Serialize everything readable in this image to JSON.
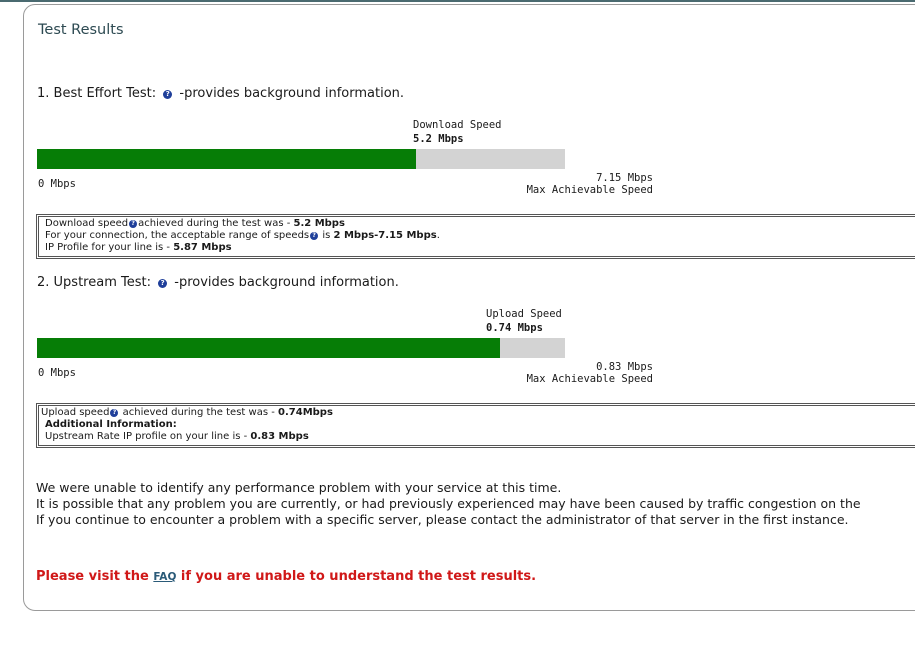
{
  "page": {
    "title": "Test Results",
    "help_icon_glyph": "?"
  },
  "best_effort": {
    "heading_prefix": "1. Best Effort Test:",
    "heading_suffix": "-provides background information.",
    "bar_title": "Download  Speed",
    "bar_value": "5.2 Mbps",
    "min_label": "0 Mbps",
    "max_value": "7.15 Mbps",
    "max_caption": "Max Achievable Speed",
    "fill_fraction": 0.718,
    "info": {
      "line1_a": "Download speed",
      "line1_b": "achieved during the test was - ",
      "line1_val": "5.2 Mbps",
      "line2_a": "For your connection, the acceptable range of speeds",
      "line2_b": " is ",
      "line2_val": "2 Mbps-7.15 Mbps",
      "line2_end": ".",
      "line3_a": "IP Profile for your line is - ",
      "line3_val": "5.87 Mbps"
    }
  },
  "upstream": {
    "heading_prefix": "2. Upstream Test:",
    "heading_suffix": "-provides background information.",
    "bar_title": "Upload Speed",
    "bar_value": "0.74 Mbps",
    "min_label": "0 Mbps",
    "max_value": "0.83 Mbps",
    "max_caption": "Max Achievable Speed",
    "fill_fraction": 0.877,
    "info": {
      "line1_a": "Upload speed",
      "line1_b": " achieved during the test was - ",
      "line1_val": "0.74Mbps",
      "line2": "Additional Information:",
      "line3_a": "Upstream Rate IP profile on your line is - ",
      "line3_val": "0.83 Mbps"
    }
  },
  "messages": {
    "line1": "We were unable to identify any performance problem with your service at this time.",
    "line2": "It is possible that any problem you are currently, or had previously experienced may have been caused by traffic congestion on the",
    "line3": "If you continue to encounter a problem with a specific server, please contact the administrator of that server in the first instance."
  },
  "faq": {
    "prefix": "Please visit the ",
    "link": "FAQ",
    "suffix": " if you are unable to understand the test results."
  },
  "colors": {
    "bar_fill": "#067d06",
    "bar_track": "#d3d3d3",
    "faq_text": "#d01818",
    "title": "#2d4a52"
  }
}
